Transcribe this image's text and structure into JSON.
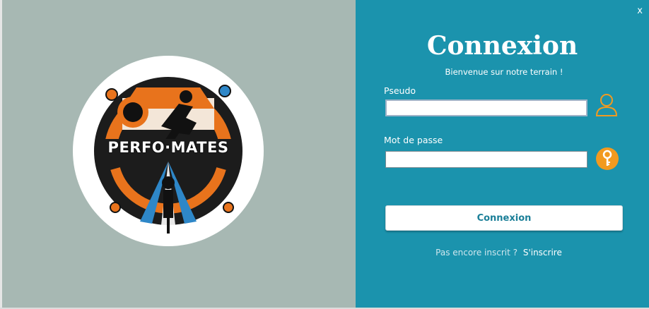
{
  "window": {
    "close_label": "x"
  },
  "logo": {
    "text": "PERFO·MATES"
  },
  "login": {
    "title": "Connexion",
    "subtitle": "Bienvenue sur notre terrain !",
    "username_label": "Pseudo",
    "username_value": "",
    "password_label": "Mot de passe",
    "password_value": "",
    "submit_label": "Connexion",
    "signup_prompt": "Pas encore inscrit ?",
    "signup_link": "S'inscrire"
  },
  "icons": {
    "user": "user-icon",
    "key": "key-icon"
  },
  "colors": {
    "left_background": "#a7b8b3",
    "right_background": "#1b93ad",
    "accent_orange": "#f29a1f",
    "button_text": "#1b7f98"
  }
}
